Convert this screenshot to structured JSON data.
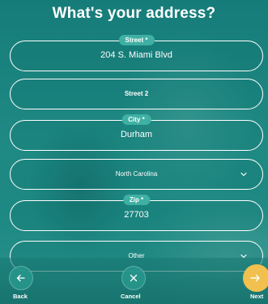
{
  "title": "What's your address?",
  "fields": {
    "street": {
      "label": "Street *",
      "value": "204 S. Miami Blvd"
    },
    "street2": {
      "placeholder": "Street 2"
    },
    "city": {
      "label": "City *",
      "value": "Durham"
    },
    "state": {
      "value": "North Carolina",
      "icon": "chevron-down-icon"
    },
    "zip": {
      "label": "Zip *",
      "value": "27703"
    },
    "other": {
      "value": "Other",
      "icon": "chevron-down-icon"
    }
  },
  "nav": {
    "back": {
      "label": "Back",
      "icon": "arrow-left-icon"
    },
    "cancel": {
      "label": "Cancel",
      "icon": "close-icon"
    },
    "next": {
      "label": "Next",
      "icon": "arrow-right-icon",
      "color": "#f1c04e"
    }
  }
}
